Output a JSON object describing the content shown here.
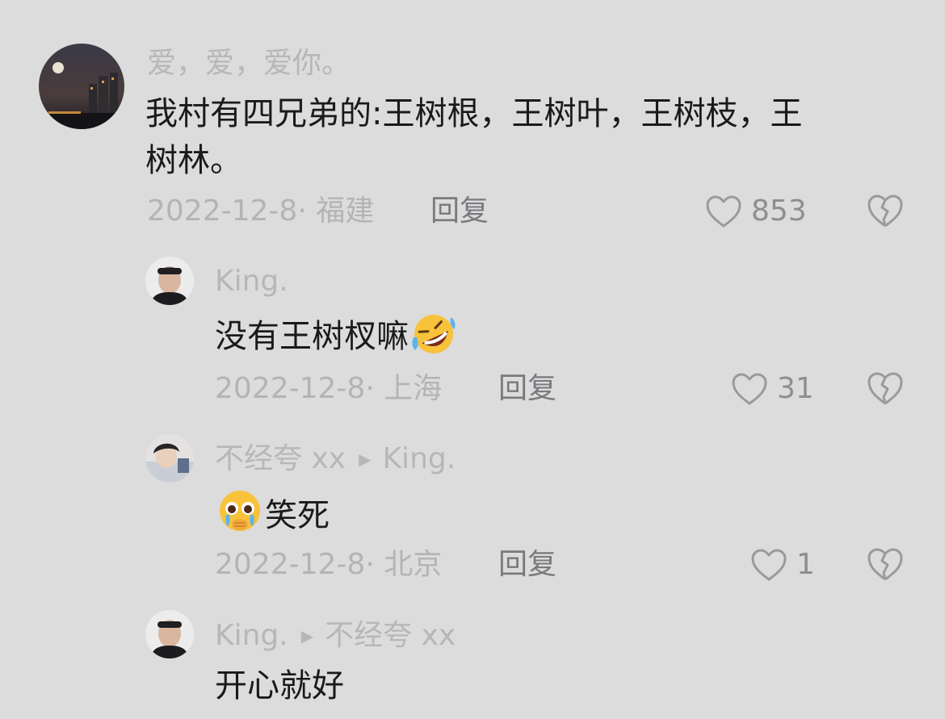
{
  "comments": [
    {
      "username": "爱，爱，爱你。",
      "text_line1": "我村有四兄弟的:王树根，王树叶，王树枝，王",
      "text_line2": "树林。",
      "date": "2022-12-8",
      "location": "福建",
      "reply_label": "回复",
      "likes": "853"
    },
    {
      "username": "King.",
      "text": "没有王树杈嘛",
      "emoji": "rofl-emoji",
      "date": "2022-12-8",
      "location": "上海",
      "reply_label": "回复",
      "likes": "31"
    },
    {
      "username": "不经夸 xx",
      "reply_to": "King.",
      "emoji": "pleading-face-emoji",
      "text": "笑死",
      "date": "2022-12-8",
      "location": "北京",
      "reply_label": "回复",
      "likes": "1"
    },
    {
      "username": "King.",
      "reply_to": "不经夸 xx",
      "text": "开心就好"
    }
  ],
  "meta_separator": "·",
  "colors": {
    "background": "#dcdcdd",
    "text": "#1a1a1a",
    "muted": "#b4b4b7",
    "icon": "#9a9a9e"
  }
}
